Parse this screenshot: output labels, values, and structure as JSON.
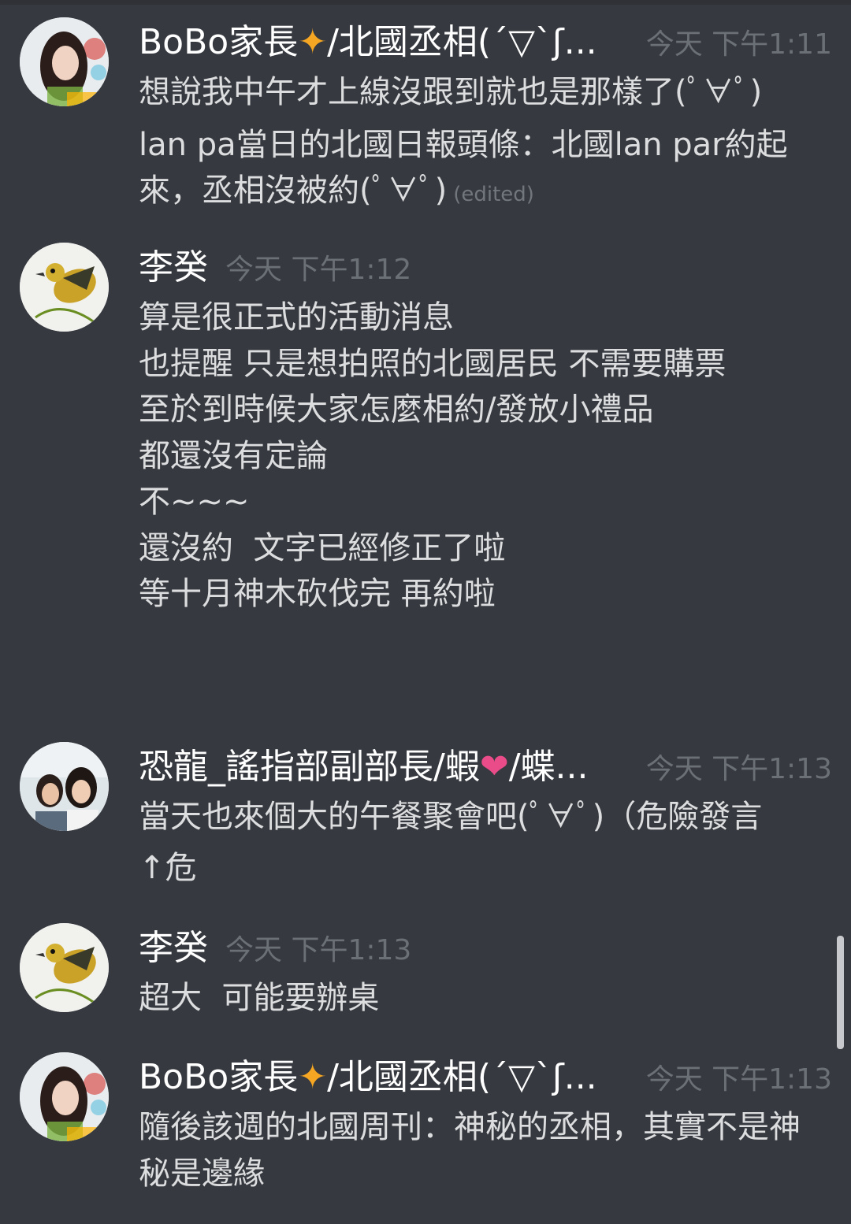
{
  "messages": [
    {
      "author": "BoBo家長",
      "author_suffix": "/北國丞相(´▽`ʃ...",
      "time": "今天 下午1:11",
      "lines": [
        "想說我中午才上線沒跟到就也是那樣了(ﾟ∀ﾟ)",
        "lan pa當日的北國日報頭條：北國lan par約起",
        "來，丞相沒被約(ﾟ∀ﾟ)"
      ],
      "edited_label": "(edited)"
    },
    {
      "author": "李癸",
      "time": "今天 下午1:12",
      "lines": [
        "算是很正式的活動消息",
        "也提醒 只是想拍照的北國居民 不需要購票",
        "",
        "至於到時候大家怎麼相約/發放小禮品",
        "都還沒有定論",
        "不~~~",
        "還沒約  文字已經修正了啦",
        "",
        "等十月神木砍伐完 再約啦"
      ]
    },
    {
      "author": "恐龍_謠指部副部長/蝦",
      "author_suffix": "/蝶...",
      "time": "今天 下午1:13",
      "lines": [
        "當天也來個大的午餐聚會吧(ﾟ∀ﾟ)（危險發言",
        "↑危"
      ]
    },
    {
      "author": "李癸",
      "time": "今天 下午1:13",
      "lines": [
        "超大  可能要辦桌"
      ]
    },
    {
      "author": "BoBo家長",
      "author_suffix": "/北國丞相(´▽`ʃ...",
      "time": "今天 下午1:13",
      "lines": [
        "隨後該週的北國周刊：神秘的丞相，其實不是神",
        "秘是邊緣"
      ]
    }
  ],
  "icons": {
    "sparkle": "sparkle-emoji",
    "heart": "heart-emoji"
  },
  "colors": {
    "background": "#36393f",
    "username": "#ffffff",
    "message_text": "#dcddde",
    "timestamp": "#6b6f76",
    "sparkle": "#f5a623",
    "heart": "#ea4c89"
  }
}
